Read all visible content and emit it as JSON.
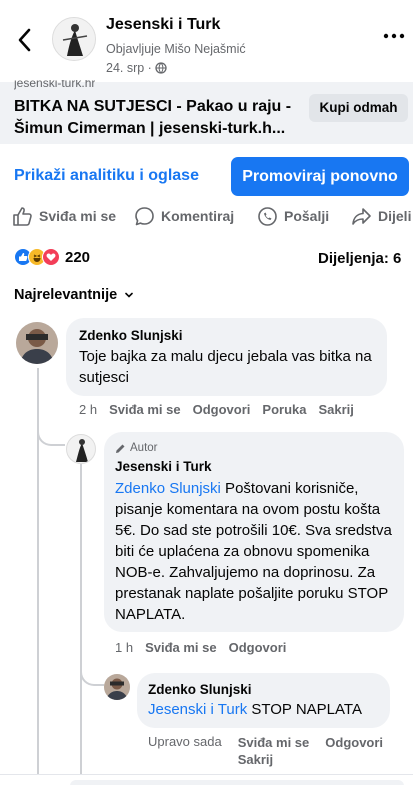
{
  "header": {
    "page_name": "Jesenski i Turk",
    "subtitle": "Objavljuje Mišo Nejašmić",
    "time": "24. srp ·"
  },
  "link_preview": {
    "domain": "jesenski-turk.hr",
    "title": "BITKA NA SUTJESCI - Pakao u raju - Šimun Cimerman | jesenski-turk.h...",
    "button": "Kupi odmah"
  },
  "actions": {
    "analytics": "Prikaži analitiku i oglase",
    "promote": "Promoviraj ponovno",
    "like": "Sviđa mi se",
    "comment": "Komentiraj",
    "send": "Pošalji",
    "share": "Dijeli"
  },
  "stats": {
    "reactions_count": "220",
    "shares": "Dijeljenja: 6"
  },
  "sort": {
    "label": "Najrelevantnije"
  },
  "comments": [
    {
      "name": "Zdenko Slunjski",
      "text": "Toje bajka za malu djecu jebala vas bitka na sutjesci",
      "meta": {
        "time": "2 h",
        "like": "Sviđa mi se",
        "reply": "Odgovori",
        "message": "Poruka",
        "hide": "Sakrij"
      }
    },
    {
      "badge": "Autor",
      "name": "Jesenski i Turk",
      "mention": "Zdenko Slunjski",
      "text": " Poštovani korisniče, pisanje komentara na ovom postu košta 5€. Do sad ste potrošili 10€. Sva sredstva biti će uplaćena za obnovu spomenika NOB-e. Zahvaljujemo na doprinosu. Za prestanak naplate pošaljite poruku STOP NAPLATA.",
      "meta": {
        "time": "1 h",
        "like": "Sviđa mi se",
        "reply": "Odgovori"
      }
    },
    {
      "name": "Zdenko Slunjski",
      "mention": "Jesenski i Turk",
      "text": " STOP NAPLATA",
      "meta": {
        "time": "Upravo sada",
        "like": "Sviđa mi se",
        "reply": "Odgovori",
        "hide": "Sakrij"
      }
    }
  ],
  "colors": {
    "accent": "#1877f2",
    "bubble": "#f0f2f5",
    "muted": "#65676b"
  }
}
